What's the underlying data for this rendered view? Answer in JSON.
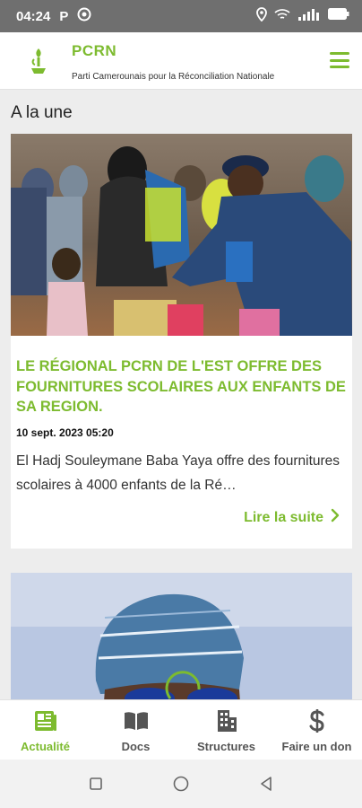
{
  "status_bar": {
    "time": "04:24",
    "app_letter": "P"
  },
  "header": {
    "title": "PCRN",
    "subtitle": "Parti Camerounais pour la  Réconciliation Nationale"
  },
  "section": {
    "title": "A la une"
  },
  "articles": [
    {
      "headline": "LE RÉGIONAL PCRN DE L'EST OFFRE DES FOURNITURES SCOLAIRES AUX ENFANTS DE SA REGION.",
      "date": "10 sept. 2023 05:20",
      "excerpt": "El Hadj Souleymane Baba Yaya offre des fournitures scolaires à 4000 enfants de la Ré…",
      "read_more": "Lire la suite"
    }
  ],
  "bottom_nav": [
    {
      "label": "Actualité",
      "icon": "newspaper-icon"
    },
    {
      "label": "Docs",
      "icon": "book-icon"
    },
    {
      "label": "Structures",
      "icon": "building-icon"
    },
    {
      "label": "Faire un don",
      "icon": "dollar-icon"
    }
  ],
  "colors": {
    "accent": "#7dbb2f",
    "status_bar": "#6f6f6f"
  }
}
